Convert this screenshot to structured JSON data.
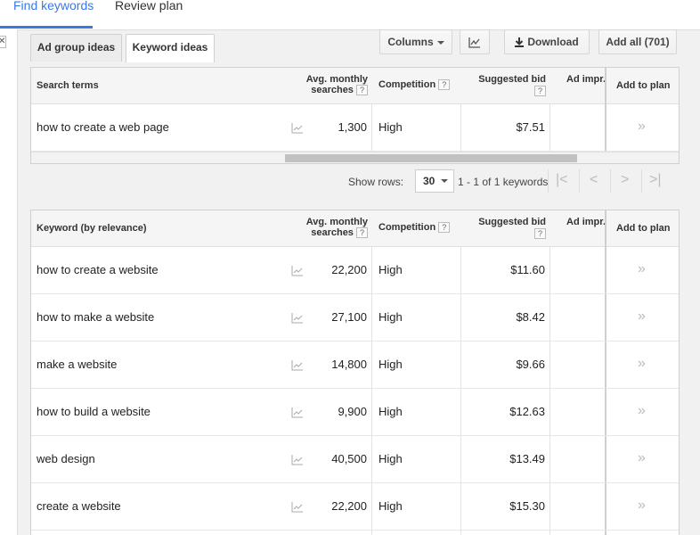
{
  "nav": {
    "tabs": [
      {
        "label": "Find keywords",
        "active": true
      },
      {
        "label": "Review plan",
        "active": false
      }
    ],
    "accent_color": "#3b78e7"
  },
  "subtabs": [
    {
      "label": "Ad group ideas",
      "active": false
    },
    {
      "label": "Keyword ideas",
      "active": true
    }
  ],
  "toolbar": {
    "columns_label": "Columns",
    "chart_icon": "line-chart-icon",
    "download_label": "Download",
    "download_icon": "download-arrow-icon",
    "add_all_label": "Add all (701)"
  },
  "search_table": {
    "headers": {
      "term": "Search terms",
      "avg_line1": "Avg. monthly",
      "avg_line2": "searches",
      "competition": "Competition",
      "bid": "Suggested bid",
      "impr": "Ad impr.",
      "add": "Add to plan"
    },
    "help_mark": "?",
    "rows": [
      {
        "term": "how to create a web page",
        "searches": "1,300",
        "competition": "High",
        "bid": "$7.51",
        "add": "»"
      }
    ]
  },
  "pager": {
    "show_rows_label": "Show rows:",
    "rows_value": "30",
    "range_text": "1 - 1 of 1 keywords",
    "first": "|<",
    "prev": "<",
    "next": ">",
    "last": ">|"
  },
  "keyword_table": {
    "headers": {
      "term": "Keyword (by relevance)",
      "avg_line1": "Avg. monthly",
      "avg_line2": "searches",
      "competition": "Competition",
      "bid": "Suggested bid",
      "impr": "Ad impr.",
      "add": "Add to plan"
    },
    "rows": [
      {
        "term": "how to create a website",
        "searches": "22,200",
        "competition": "High",
        "bid": "$11.60",
        "add": "»"
      },
      {
        "term": "how to make a website",
        "searches": "27,100",
        "competition": "High",
        "bid": "$8.42",
        "add": "»"
      },
      {
        "term": "make a website",
        "searches": "14,800",
        "competition": "High",
        "bid": "$9.66",
        "add": "»"
      },
      {
        "term": "how to build a website",
        "searches": "9,900",
        "competition": "High",
        "bid": "$12.63",
        "add": "»"
      },
      {
        "term": "web design",
        "searches": "40,500",
        "competition": "High",
        "bid": "$13.49",
        "add": "»"
      },
      {
        "term": "create a website",
        "searches": "22,200",
        "competition": "High",
        "bid": "$15.30",
        "add": "»"
      }
    ]
  }
}
